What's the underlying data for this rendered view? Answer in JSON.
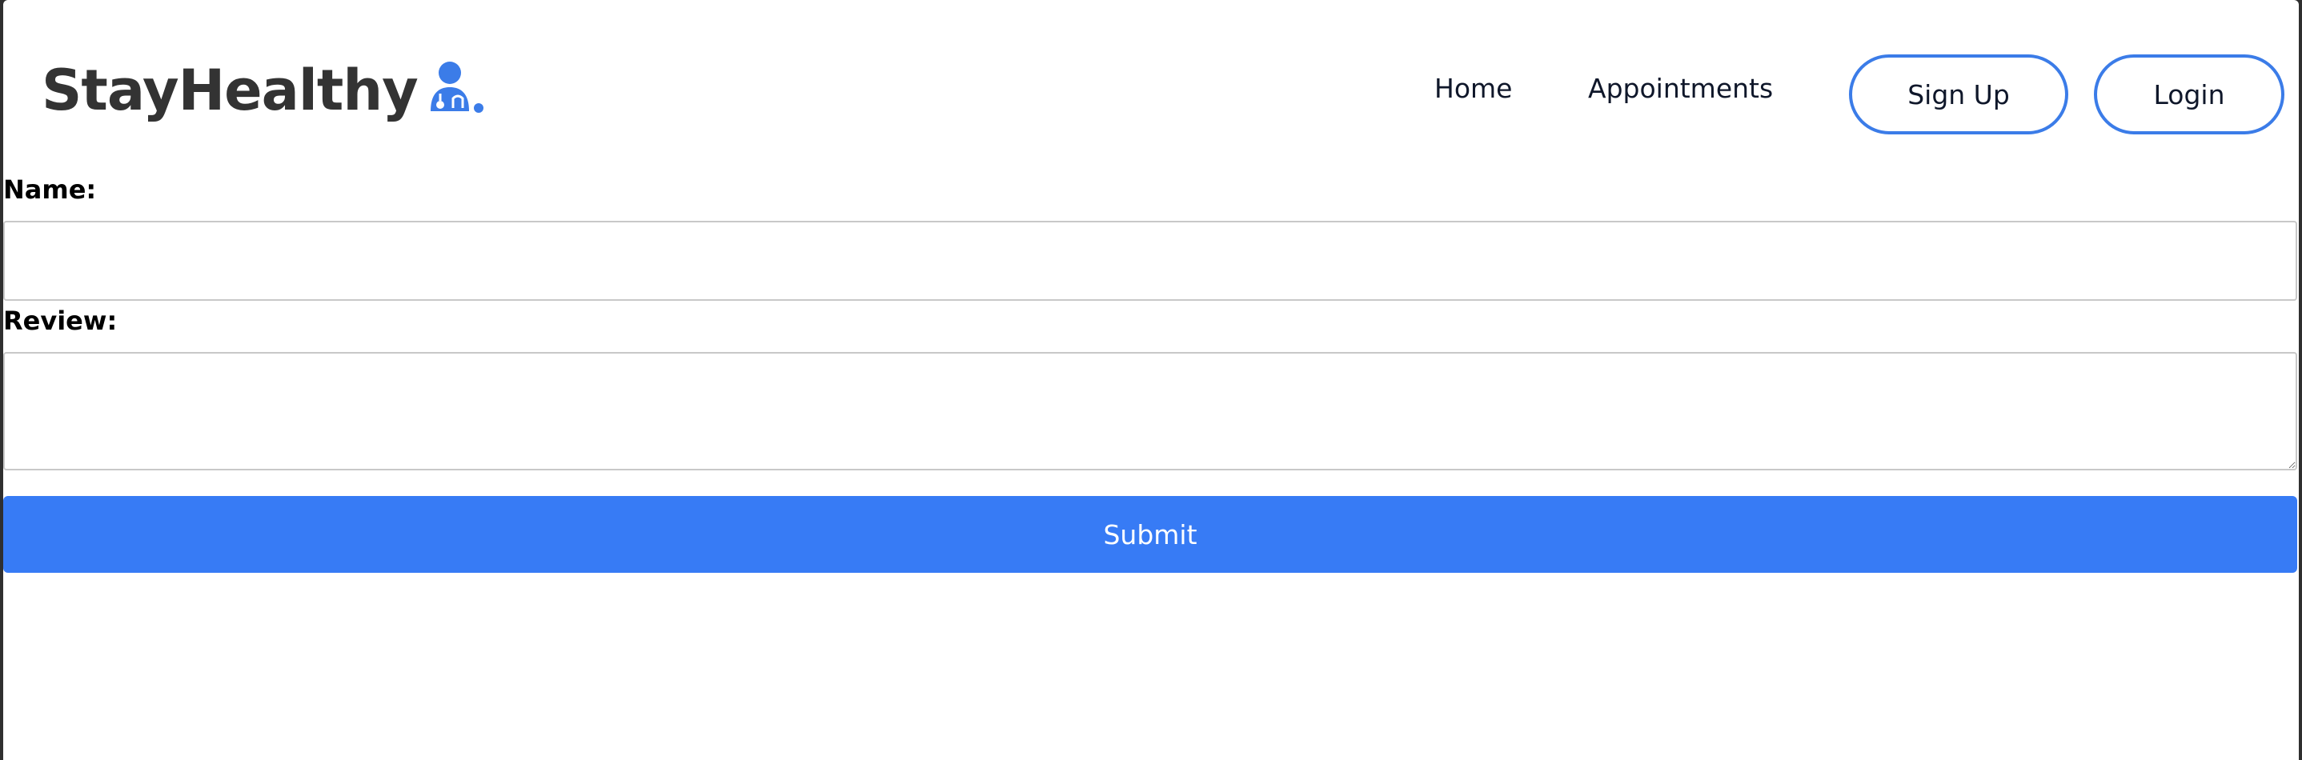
{
  "navbar": {
    "brand": "StayHealthy",
    "brand_icon": "doctor-icon",
    "links": {
      "home": "Home",
      "appointments": "Appointments"
    },
    "buttons": {
      "signup": "Sign Up",
      "login": "Login"
    }
  },
  "form": {
    "name_label": "Name:",
    "name_value": "",
    "name_placeholder": "",
    "review_label": "Review:",
    "review_value": "",
    "review_placeholder": "",
    "submit_label": "Submit"
  },
  "colors": {
    "accent": "#377bf5",
    "button_border": "#3b7ce8",
    "brand_text": "#333333",
    "icon": "#3b7ce8"
  }
}
